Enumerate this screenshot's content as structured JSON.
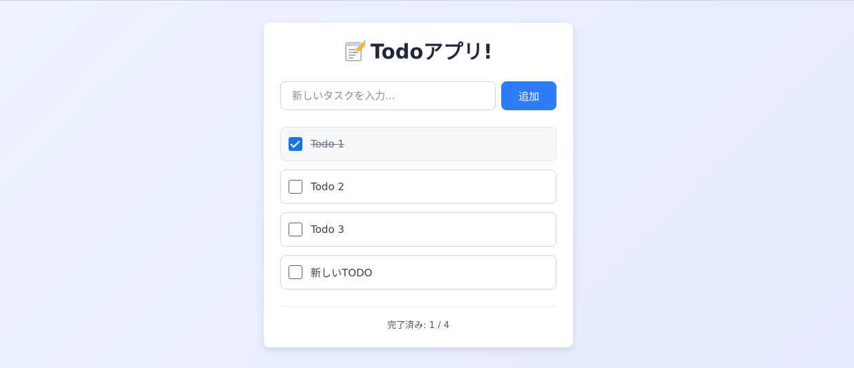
{
  "app": {
    "title": "Todoアプリ!",
    "title_icon": "memo-pencil-icon"
  },
  "form": {
    "input_placeholder": "新しいタスクを入力...",
    "input_value": "",
    "add_label": "追加"
  },
  "todos": [
    {
      "text": "Todo 1",
      "completed": true
    },
    {
      "text": "Todo 2",
      "completed": false
    },
    {
      "text": "Todo 3",
      "completed": false
    },
    {
      "text": "新しいTODO",
      "completed": false
    }
  ],
  "footer": {
    "label": "完了済み:",
    "count": "1 / 4"
  },
  "colors": {
    "accent": "#2f7cf6",
    "checkbox_checked": "#1a73e8",
    "background": "#eef2ff",
    "text": "#1f2937"
  }
}
